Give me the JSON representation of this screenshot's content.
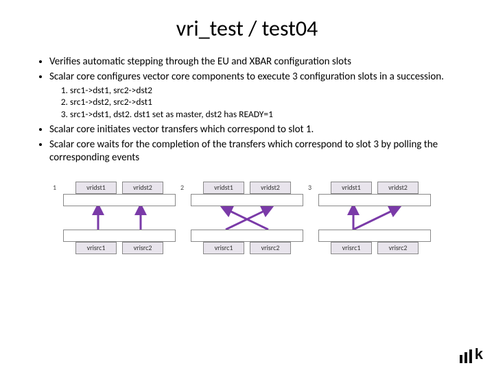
{
  "title": "vri_test / test04",
  "bullets": [
    "Verifies automatic stepping through the EU and XBAR configuration slots",
    "Scalar core configures vector core components to execute 3 configuration slots in a succession."
  ],
  "sub_items": [
    "src1->dst1, src2->dst2",
    "src1->dst2, src2->dst1",
    "src1->dst1, dst2. dst1 set as master, dst2 has READY=1"
  ],
  "bullets_after": [
    "Scalar core initiates vector transfers which correspond to slot 1.",
    "Scalar core waits for the completion of the transfers which correspond to slot 3 by polling the corresponding events"
  ],
  "slots": [
    {
      "label": "1",
      "dst": [
        "vridst1",
        "vridst2"
      ],
      "src": [
        "vrisrc1",
        "vrisrc2"
      ],
      "arrows": "parallel"
    },
    {
      "label": "2",
      "dst": [
        "vridst1",
        "vridst2"
      ],
      "src": [
        "vrisrc1",
        "vrisrc2"
      ],
      "arrows": "cross"
    },
    {
      "label": "3",
      "dst": [
        "vridst1",
        "vridst2"
      ],
      "src": [
        "vrisrc1",
        "vrisrc2"
      ],
      "arrows": "fanout"
    }
  ],
  "logo_text": "k"
}
